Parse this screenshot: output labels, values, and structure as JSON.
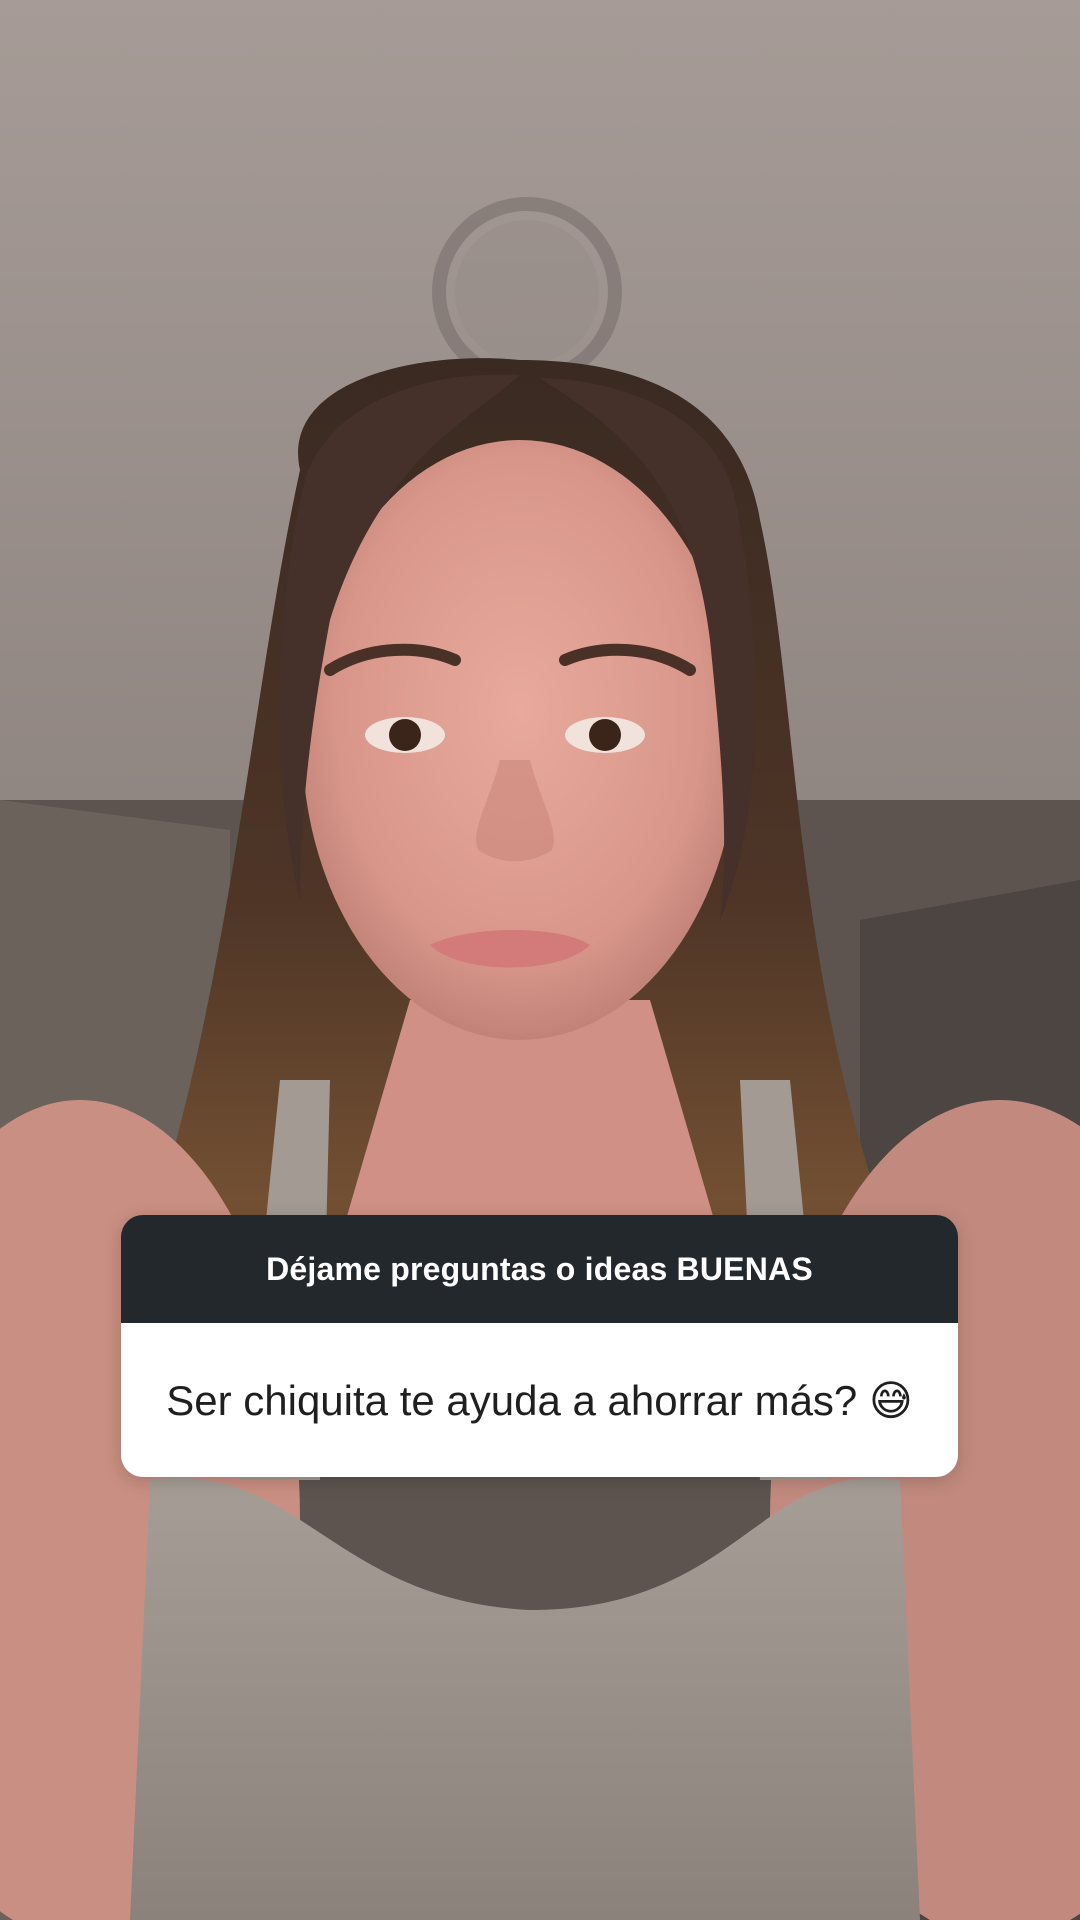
{
  "question_sticker": {
    "prompt": "Déjame preguntas o ideas BUENAS",
    "answer": "Ser chiquita te ayuda a ahorrar más? 😅"
  },
  "colors": {
    "sticker_header": "#23282d",
    "sticker_body": "#ffffff",
    "prompt_text": "#ffffff",
    "answer_text": "#1f1f1f"
  }
}
